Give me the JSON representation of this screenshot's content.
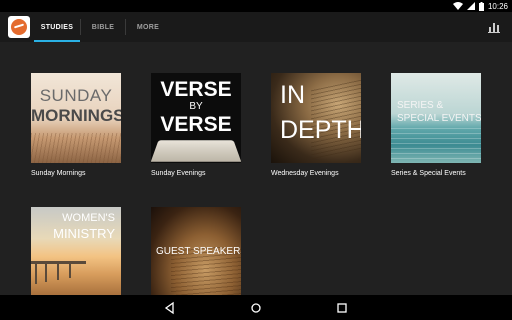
{
  "status_bar": {
    "time": "10:26"
  },
  "tabs": [
    {
      "label": "STUDIES",
      "active": true
    },
    {
      "label": "BIBLE",
      "active": false
    },
    {
      "label": "MORE",
      "active": false
    }
  ],
  "studies": [
    {
      "caption": "Sunday Mornings",
      "art_text": [
        "SUNDAY",
        "MORNINGS"
      ]
    },
    {
      "caption": "Sunday Evenings",
      "art_text": [
        "VERSE",
        "BY",
        "VERSE"
      ]
    },
    {
      "caption": "Wednesday Evenings",
      "art_text": [
        "IN",
        "DEPTH"
      ]
    },
    {
      "caption": "Series & Special Events",
      "art_text": [
        "SERIES &",
        "SPECIAL EVENTS"
      ]
    },
    {
      "caption": "",
      "art_text": [
        "WOMEN'S",
        "MINISTRY"
      ]
    },
    {
      "caption": "",
      "art_text": [
        "GUEST SPEAKERS"
      ]
    }
  ],
  "colors": {
    "accent": "#2ab1e4",
    "background": "#212121",
    "app_bar": "#1a1a1a"
  }
}
